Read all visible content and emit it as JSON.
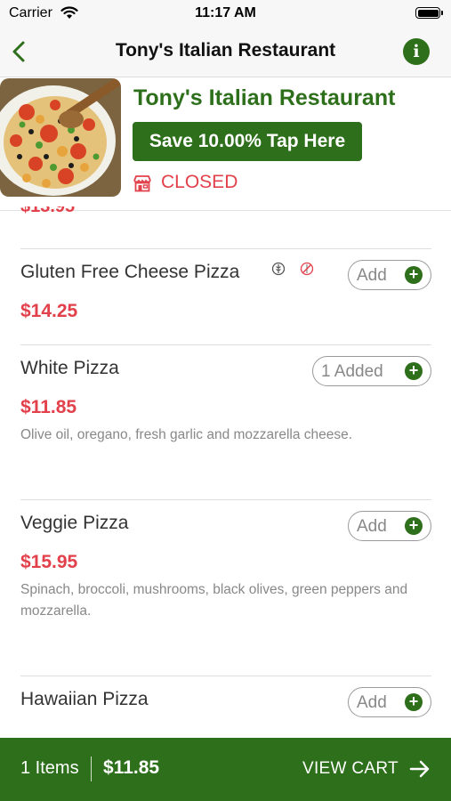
{
  "status_bar": {
    "carrier": "Carrier",
    "time": "11:17 AM"
  },
  "nav": {
    "title": "Tony's Italian Restaurant",
    "back_icon": "chevron-left-icon",
    "info_icon": "info-icon",
    "info_glyph": "i"
  },
  "restaurant": {
    "name": "Tony's Italian Restaurant",
    "promo_label": "Save 10.00% Tap Here",
    "status": "CLOSED",
    "status_icon": "store-icon"
  },
  "partial_price": "$13.95",
  "menu": {
    "items": [
      {
        "name": "Gluten Free Cheese Pizza",
        "price": "$14.25",
        "description": "",
        "button_label": "Add",
        "diet_icons": [
          "gluten-free-icon",
          "no-gluten-icon"
        ]
      },
      {
        "name": "White Pizza",
        "price": "$11.85",
        "description": "Olive oil, oregano, fresh garlic and mozzarella cheese.",
        "button_label": "1 Added"
      },
      {
        "name": "Veggie Pizza",
        "price": "$15.95",
        "description": "Spinach, broccoli, mushrooms, black olives, green peppers and mozzarella.",
        "button_label": "Add"
      },
      {
        "name": "Hawaiian Pizza",
        "price": "",
        "description": "",
        "button_label": "Add"
      }
    ]
  },
  "cart": {
    "count": "1 Items",
    "total": "$11.85",
    "view_label": "VIEW CART",
    "arrow_icon": "arrow-right-icon"
  },
  "colors": {
    "brand_green": "#2e6f1b",
    "price_red": "#e2404a",
    "status_red": "#e2404a"
  }
}
